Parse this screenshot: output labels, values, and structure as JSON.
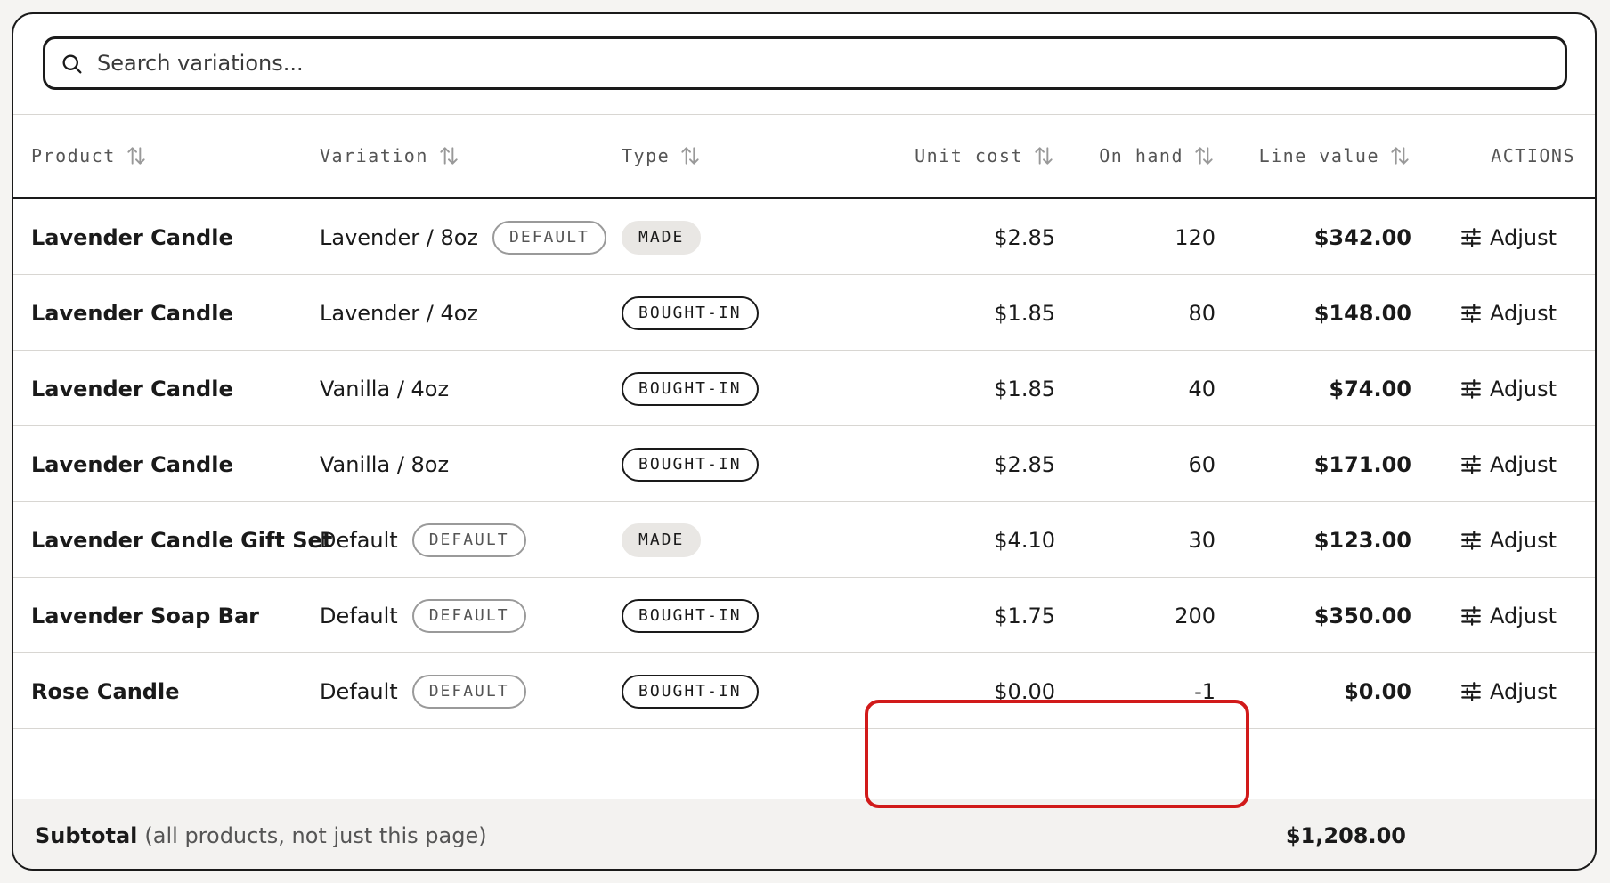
{
  "search": {
    "placeholder": "Search variations..."
  },
  "table": {
    "headers": {
      "product": "Product",
      "variation": "Variation",
      "type": "Type",
      "unit_cost": "Unit cost",
      "on_hand": "On hand",
      "line_value": "Line value",
      "actions": "ACTIONS"
    },
    "rows": [
      {
        "product": "Lavender Candle",
        "variation": "Lavender / 8oz",
        "default_badge": "DEFAULT",
        "type": "MADE",
        "unit_cost": "$2.85",
        "on_hand": "120",
        "line_value": "$342.00",
        "action": "Adjust"
      },
      {
        "product": "Lavender Candle",
        "variation": "Lavender / 4oz",
        "default_badge": "",
        "type": "BOUGHT-IN",
        "unit_cost": "$1.85",
        "on_hand": "80",
        "line_value": "$148.00",
        "action": "Adjust"
      },
      {
        "product": "Lavender Candle",
        "variation": "Vanilla / 4oz",
        "default_badge": "",
        "type": "BOUGHT-IN",
        "unit_cost": "$1.85",
        "on_hand": "40",
        "line_value": "$74.00",
        "action": "Adjust"
      },
      {
        "product": "Lavender Candle",
        "variation": "Vanilla / 8oz",
        "default_badge": "",
        "type": "BOUGHT-IN",
        "unit_cost": "$2.85",
        "on_hand": "60",
        "line_value": "$171.00",
        "action": "Adjust"
      },
      {
        "product": "Lavender Candle Gift Set",
        "variation": "Default",
        "default_badge": "DEFAULT",
        "type": "MADE",
        "unit_cost": "$4.10",
        "on_hand": "30",
        "line_value": "$123.00",
        "action": "Adjust"
      },
      {
        "product": "Lavender Soap Bar",
        "variation": "Default",
        "default_badge": "DEFAULT",
        "type": "BOUGHT-IN",
        "unit_cost": "$1.75",
        "on_hand": "200",
        "line_value": "$350.00",
        "action": "Adjust"
      },
      {
        "product": "Rose Candle",
        "variation": "Default",
        "default_badge": "DEFAULT",
        "type": "BOUGHT-IN",
        "unit_cost": "$0.00",
        "on_hand": "-1",
        "line_value": "$0.00",
        "action": "Adjust"
      }
    ],
    "subtotal": {
      "label": "Subtotal",
      "note": "(all products, not just this page)",
      "amount": "$1,208.00"
    }
  },
  "colors": {
    "highlight": "#d11a1a",
    "border": "#1a1a1a",
    "muted": "#555555"
  },
  "icons": {
    "search": "search-icon",
    "sort": "sort-arrows-icon",
    "adjust": "sliders-icon"
  }
}
